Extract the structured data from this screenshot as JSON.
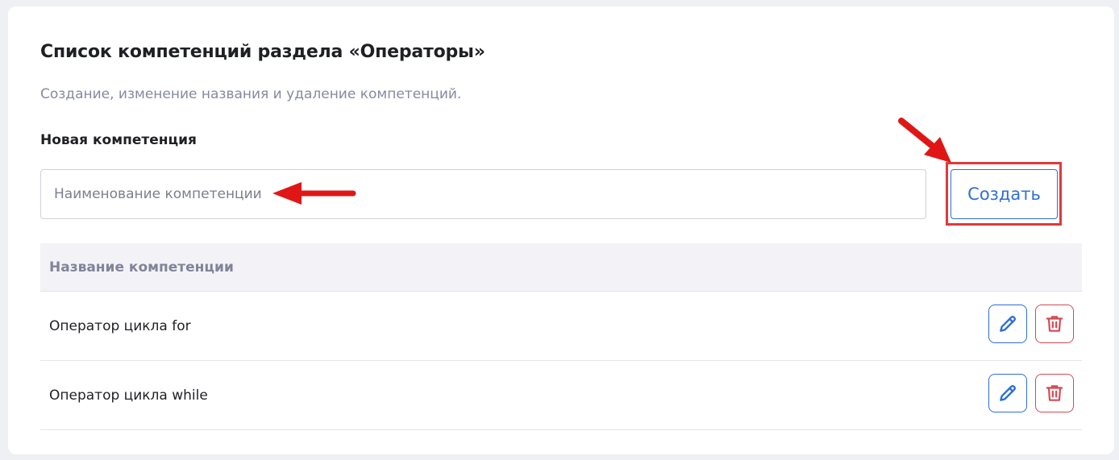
{
  "page": {
    "title": "Список компетенций раздела «Операторы»",
    "subtitle": "Создание, изменение названия и удаление компетенций."
  },
  "form": {
    "label": "Новая компетенция",
    "input_value": "",
    "input_placeholder": "Наименование компетенции",
    "create_label": "Создать"
  },
  "table": {
    "header": "Название компетенции",
    "rows": [
      {
        "name": "Оператор цикла for",
        "edit_icon": "pencil-icon",
        "delete_icon": "trash-icon"
      },
      {
        "name": "Оператор цикла while",
        "edit_icon": "pencil-icon",
        "delete_icon": "trash-icon"
      }
    ]
  },
  "colors": {
    "primary": "#2f6fd6",
    "danger": "#d44a52",
    "annotation": "#e03a3a",
    "header_bg": "#f3f3f7"
  }
}
